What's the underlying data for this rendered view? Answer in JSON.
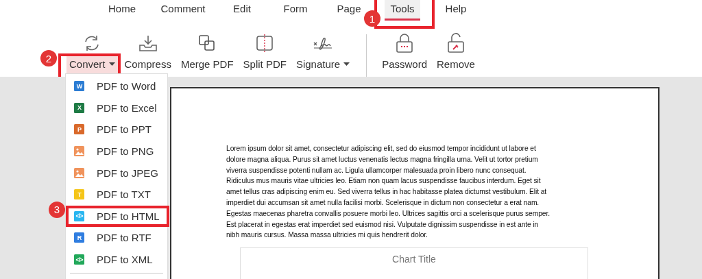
{
  "menu_tabs": [
    {
      "label": "Home",
      "selected": false
    },
    {
      "label": "Comment",
      "selected": false
    },
    {
      "label": "Edit",
      "selected": false
    },
    {
      "label": "Form",
      "selected": false
    },
    {
      "label": "Page",
      "selected": false
    },
    {
      "label": "Tools",
      "selected": true,
      "highlighted": true,
      "callout": "1"
    },
    {
      "label": "Help",
      "selected": false
    }
  ],
  "toolbar": [
    {
      "kind": "convert",
      "label": "Convert",
      "dropdown": true,
      "pressed": true,
      "highlighted": true,
      "callout": "2"
    },
    {
      "kind": "compress",
      "label": "Compress",
      "dropdown": false,
      "pressed": false
    },
    {
      "kind": "merge",
      "label": "Merge PDF",
      "dropdown": false,
      "pressed": false
    },
    {
      "kind": "split",
      "label": "Split PDF",
      "dropdown": false,
      "pressed": false
    },
    {
      "kind": "signature",
      "label": "Signature",
      "dropdown": true,
      "pressed": false
    },
    {
      "kind": "separator"
    },
    {
      "kind": "password",
      "label": "Password",
      "dropdown": false,
      "pressed": false
    },
    {
      "kind": "remove",
      "label": "Remove",
      "dropdown": false,
      "pressed": false
    }
  ],
  "convert_menu": [
    {
      "label": "PDF to Word",
      "icon": {
        "kind": "letter",
        "text": "W",
        "color": "#2b7cd3"
      },
      "highlighted": false
    },
    {
      "label": "PDF to Excel",
      "icon": {
        "kind": "letter",
        "text": "X",
        "color": "#1e7b45"
      },
      "highlighted": false
    },
    {
      "label": "PDF to PPT",
      "icon": {
        "kind": "letter",
        "text": "P",
        "color": "#d9692b"
      },
      "highlighted": false
    },
    {
      "label": "PDF to PNG",
      "icon": {
        "kind": "image",
        "color": "#f0935c"
      },
      "highlighted": false
    },
    {
      "label": "PDF to JPEG",
      "icon": {
        "kind": "image",
        "color": "#f0935c"
      },
      "highlighted": false
    },
    {
      "label": "PDF to TXT",
      "icon": {
        "kind": "letter",
        "text": "T",
        "color": "#f5c518"
      },
      "highlighted": false
    },
    {
      "label": "PDF to HTML",
      "icon": {
        "kind": "letter",
        "text": "</>",
        "color": "#29b6f0"
      },
      "highlighted": true,
      "callout": "3"
    },
    {
      "label": "PDF to RTF",
      "icon": {
        "kind": "letter",
        "text": "R",
        "color": "#2f7de0"
      },
      "highlighted": false
    },
    {
      "label": "PDF to XML",
      "icon": {
        "kind": "letter",
        "text": "</>",
        "color": "#21a85a"
      },
      "highlighted": false
    }
  ],
  "document": {
    "paragraph_lines": [
      "Lorem ipsum dolor sit amet, consectetur adipiscing elit, sed do eiusmod tempor incididunt ut labore et",
      "dolore magna aliqua. Purus sit amet luctus venenatis lectus magna fringilla urna. Velit ut tortor pretium",
      "viverra suspendisse potenti nullam ac. Ligula ullamcorper malesuada proin libero nunc consequat.",
      "Ridiculus mus mauris vitae ultricies leo. Etiam non quam lacus suspendisse faucibus interdum. Eget sit",
      "amet tellus cras adipiscing enim eu. Sed viverra tellus in hac habitasse platea dictumst vestibulum. Elit at",
      "imperdiet dui accumsan sit amet nulla facilisi morbi. Scelerisque in dictum non consectetur a erat nam.",
      "Egestas maecenas pharetra convallis posuere morbi leo. Ultrices sagittis orci a scelerisque purus semper.",
      "Est placerat in egestas erat imperdiet sed euismod nisi. Vulputate dignissim suspendisse in est ante in",
      "nibh mauris cursus. Massa massa ultricies mi quis hendrerit dolor."
    ],
    "chart_title": "Chart Title"
  }
}
